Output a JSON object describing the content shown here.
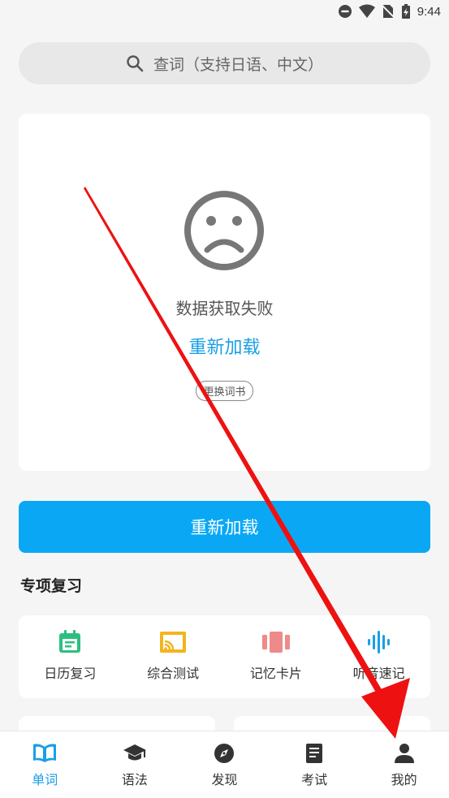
{
  "status_bar": {
    "time": "9:44"
  },
  "search": {
    "placeholder": "查词（支持日语、中文）"
  },
  "empty_state": {
    "message": "数据获取失败",
    "reload_link": "重新加载",
    "change_book": "更换词书"
  },
  "reload_button": "重新加载",
  "special_review": {
    "title": "专项复习",
    "items": [
      {
        "label": "日历复习",
        "icon": "calendar-icon",
        "color": "#2dbf7e"
      },
      {
        "label": "综合测试",
        "icon": "cast-icon",
        "color": "#f3b51d"
      },
      {
        "label": "记忆卡片",
        "icon": "cards-icon",
        "color": "#ef8a8a"
      },
      {
        "label": "听音速记",
        "icon": "soundwave-icon",
        "color": "#1a9fe6"
      }
    ]
  },
  "tabs": [
    {
      "label": "单词",
      "icon": "book-icon",
      "active": true
    },
    {
      "label": "语法",
      "icon": "graduation-cap-icon",
      "active": false
    },
    {
      "label": "发现",
      "icon": "compass-icon",
      "active": false
    },
    {
      "label": "考试",
      "icon": "document-icon",
      "active": false
    },
    {
      "label": "我的",
      "icon": "person-icon",
      "active": false
    }
  ],
  "colors": {
    "accent": "#1a9fe6",
    "button": "#0aa8f4",
    "annotation_arrow": "#ee1111"
  }
}
